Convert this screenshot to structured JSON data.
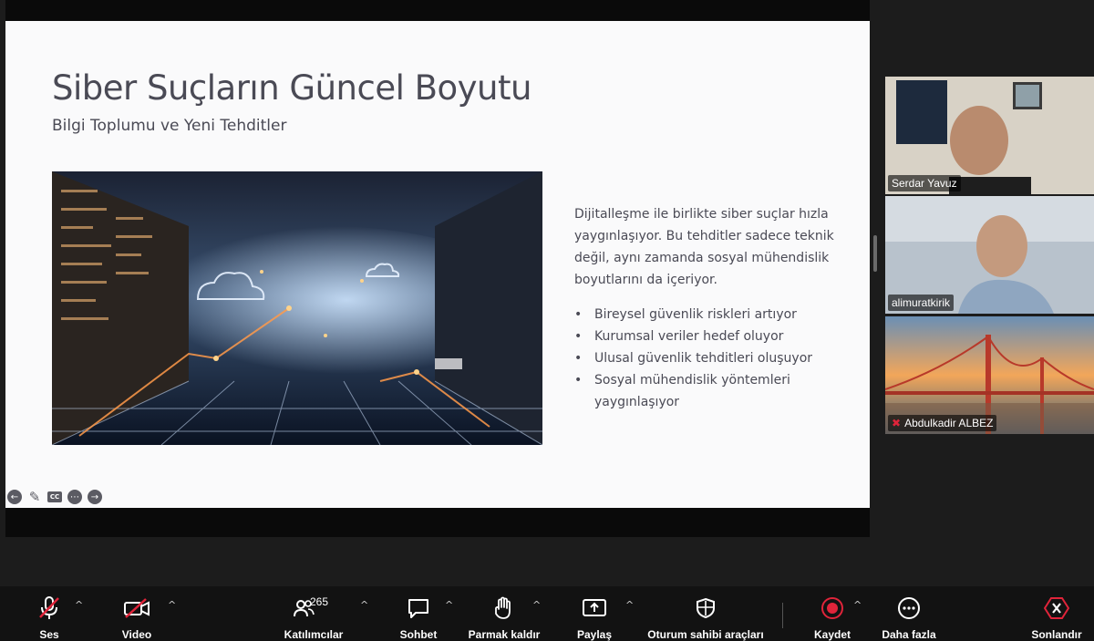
{
  "slide": {
    "title": "Siber Suçların Güncel Boyutu",
    "subtitle": "Bilgi Toplumu ve Yeni Tehditler",
    "paragraph": "Dijitalleşme ile birlikte siber suçlar hızla yaygınlaşıyor. Bu tehditler sadece teknik değil, aynı zamanda sosyal mühendislik boyutlarını da içeriyor.",
    "bullets": [
      "Bireysel güvenlik riskleri artıyor",
      "Kurumsal veriler hedef oluyor",
      "Ulusal güvenlik tehditleri oluşuyor",
      "Sosyal mühendislik yöntemleri yaygınlaşıyor"
    ],
    "controls": {
      "cc": "CC"
    }
  },
  "participants": [
    {
      "name": "Serdar Yavuz",
      "active": false
    },
    {
      "name": "alimuratkirik",
      "active": true
    },
    {
      "name": "Abdulkadir ALBEZ",
      "active": false,
      "muted": true
    }
  ],
  "toolbar": {
    "audio": "Ses",
    "video": "Video",
    "participants": "Katılımcılar",
    "participants_count": "265",
    "chat": "Sohbet",
    "raise_hand": "Parmak kaldır",
    "share": "Paylaş",
    "host_tools": "Oturum sahibi araçları",
    "record": "Kaydet",
    "more": "Daha fazla",
    "end": "Sonlandır"
  },
  "colors": {
    "accent_active": "#23d959",
    "muted_red": "#e0243a",
    "record_red": "#e0243a"
  }
}
